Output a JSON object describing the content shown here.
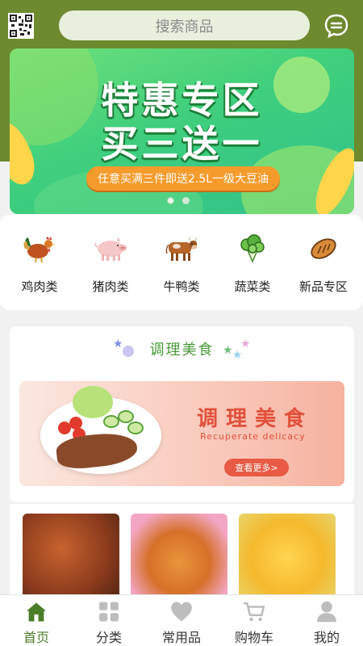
{
  "header": {
    "search_placeholder": "搜索商品"
  },
  "banner": {
    "title_line1": "特惠专区",
    "title_line2": "买三送一",
    "subtitle": "任意买满三件即送2.5L一级大豆油",
    "slide_count": 2,
    "active_slide": 1
  },
  "categories": [
    {
      "label": "鸡肉类",
      "icon": "rooster-icon"
    },
    {
      "label": "猪肉类",
      "icon": "pig-icon"
    },
    {
      "label": "牛鸭类",
      "icon": "cow-icon"
    },
    {
      "label": "蔬菜类",
      "icon": "vegetable-icon"
    },
    {
      "label": "新品专区",
      "icon": "bread-icon"
    }
  ],
  "section": {
    "title": "调理美食",
    "banner_title": "调理美食",
    "banner_subtitle": "Recuperate delicacy",
    "more_label": "查看更多>"
  },
  "tabs": [
    {
      "label": "首页",
      "icon": "home-icon",
      "active": true
    },
    {
      "label": "分类",
      "icon": "grid-icon",
      "active": false
    },
    {
      "label": "常用品",
      "icon": "heart-icon",
      "active": false
    },
    {
      "label": "购物车",
      "icon": "cart-icon",
      "active": false
    },
    {
      "label": "我的",
      "icon": "user-icon",
      "active": false
    }
  ],
  "colors": {
    "brand_green": "#6d8a2f",
    "active_tab": "#4c7d2a",
    "accent_orange": "#f59b2c",
    "accent_red": "#e85a44"
  }
}
